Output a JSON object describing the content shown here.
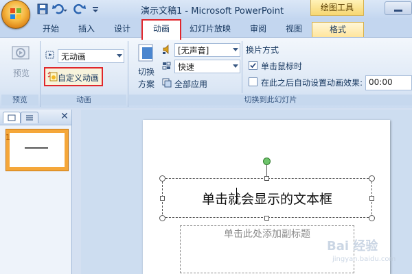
{
  "window": {
    "title": "演示文稿1 - Microsoft PowerPoint",
    "contextual_tab_group": "绘图工具"
  },
  "tabs": [
    {
      "label": "开始"
    },
    {
      "label": "插入"
    },
    {
      "label": "设计"
    },
    {
      "label": "动画",
      "active": true
    },
    {
      "label": "幻灯片放映"
    },
    {
      "label": "审阅"
    },
    {
      "label": "视图"
    },
    {
      "label": "格式"
    }
  ],
  "ribbon": {
    "preview_group": {
      "button": "预览",
      "label": "预览"
    },
    "animation_group": {
      "animation_select": "无动画",
      "custom_animation": "自定义动画",
      "label": "动画"
    },
    "transition_group": {
      "switch_scheme_line1": "切换",
      "switch_scheme_line2": "方案",
      "sound_select": "[无声音]",
      "speed_select": "快速",
      "apply_all": "全部应用",
      "advance_title": "换片方式",
      "on_click_label": "单击鼠标时",
      "on_click_checked": true,
      "auto_after_label": "在此之后自动设置动画效果:",
      "auto_after_checked": false,
      "time_value": "00:00",
      "label": "切换到此幻灯片"
    }
  },
  "slides_pane": {
    "thumbnail_number": "1"
  },
  "slide": {
    "title_text": "单击就会显示的文本框",
    "subtitle_placeholder": "单击此处添加副标题"
  },
  "watermark": {
    "text": "Bai 经验",
    "sub": "jingyan.baidu.com"
  },
  "colors": {
    "highlight_red": "#e0262b",
    "ribbon_bg": "#dce7f5",
    "office_orange": "#f5b63f",
    "thumbnail_selected": "#f5a73a"
  }
}
